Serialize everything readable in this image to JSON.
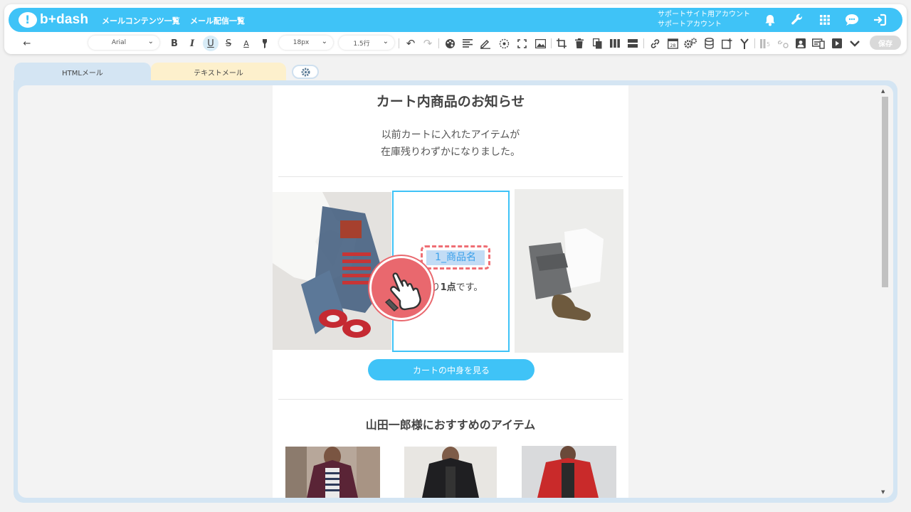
{
  "app": {
    "logo_text": "b+dash",
    "nav": [
      "メールコンテンツ一覧",
      "メール配信一覧"
    ],
    "account_line1": "サポートサイト用アカウント",
    "account_line2": "サポートアカウント",
    "top_icons": [
      "bell-icon",
      "wrench-icon",
      "grid-icon",
      "chat-icon",
      "logout-icon"
    ]
  },
  "toolbar": {
    "font_family": "Arial",
    "font_size": "18px",
    "line_height": "1.5行",
    "save_label": "保存"
  },
  "tabs": {
    "html": "HTMLメール",
    "text": "テキストメール"
  },
  "mail": {
    "title": "カート内商品のお知らせ",
    "lead_line1": "以前カートに入れたアイテムが",
    "lead_line2": "在庫残りわずかになりました。",
    "item_name": "1_商品名",
    "stock_prefix": "残り",
    "stock_count": "1点",
    "stock_suffix": "です。",
    "cart_button": "カートの中身を見る",
    "recommend_title": "山田一郎様におすすめのアイテム"
  },
  "colors": {
    "accent": "#3fc3f7",
    "highlight": "#ef6e74"
  }
}
